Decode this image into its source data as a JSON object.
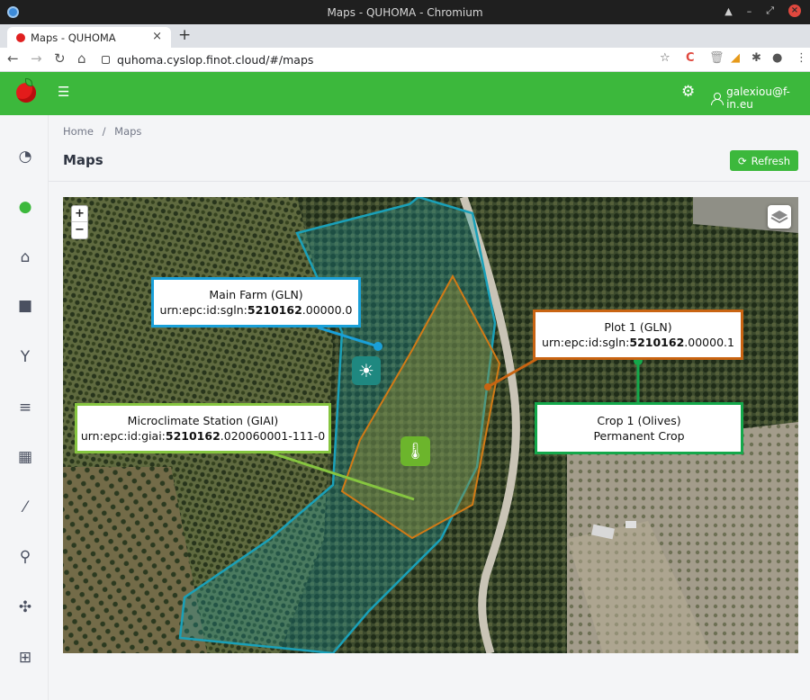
{
  "window": {
    "title": "Maps - QUHOMA - Chromium"
  },
  "browser": {
    "tab_title": "Maps - QUHOMA",
    "tab_close": "×",
    "new_tab": "+",
    "url": "quhoma.cyslop.finot.cloud/#/maps"
  },
  "header": {
    "user_email": "galexiou@f-in.eu"
  },
  "sidebar": {
    "items": [
      {
        "icon": "dashboard-gauge-icon"
      },
      {
        "icon": "globe-icon"
      },
      {
        "icon": "farm-building-icon"
      },
      {
        "icon": "stack-icon"
      },
      {
        "icon": "sprout-icon"
      },
      {
        "icon": "harvester-icon"
      },
      {
        "icon": "calendar-icon"
      },
      {
        "icon": "spray-icon"
      },
      {
        "icon": "route-icon"
      },
      {
        "icon": "network-icon"
      },
      {
        "icon": "grid-icon"
      }
    ]
  },
  "breadcrumb": {
    "home": "Home",
    "separator": "/",
    "current": "Maps"
  },
  "page": {
    "title": "Maps",
    "refresh_label": "Refresh"
  },
  "map": {
    "zoom_in": "+",
    "zoom_out": "−",
    "callouts": {
      "main_farm": {
        "title": "Main Farm (GLN)",
        "prefix": "urn:epc:id:sgln:",
        "bold": "5210162",
        "suffix": ".00000.0"
      },
      "plot": {
        "title": "Plot 1 (GLN)",
        "prefix": "urn:epc:id:sgln:",
        "bold": "5210162",
        "suffix": ".00000.1"
      },
      "crop": {
        "title": "Crop 1 (Olives)",
        "subtitle": "Permanent Crop"
      },
      "micro": {
        "title": "Microclimate Station (GIAI)",
        "prefix": "urn:epc:id:giai:",
        "bold": "5210162",
        "suffix": ".020060001-111-0"
      }
    }
  },
  "colors": {
    "brand_green": "#3cb83c",
    "farm_outline": "#1aa0d8",
    "plot_outline": "#c96412",
    "crop_outline": "#14a84b",
    "micro_outline": "#86c540"
  }
}
